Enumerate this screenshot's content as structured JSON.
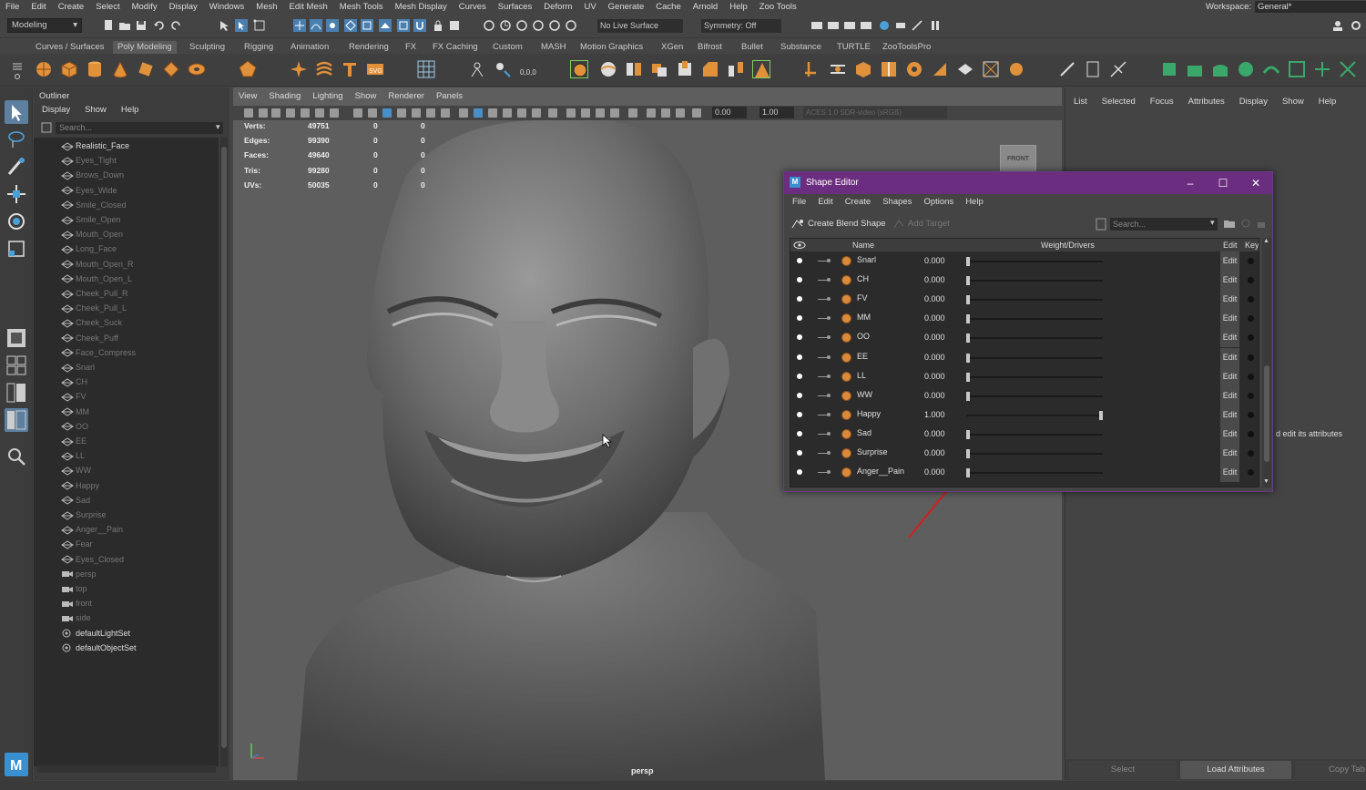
{
  "menubar": {
    "items": [
      "File",
      "Edit",
      "Create",
      "Select",
      "Modify",
      "Display",
      "Windows",
      "Mesh",
      "Edit Mesh",
      "Mesh Tools",
      "Mesh Display",
      "Curves",
      "Surfaces",
      "Deform",
      "UV",
      "Generate",
      "Cache",
      "Arnold",
      "Help",
      "Zoo Tools"
    ],
    "workspace_label": "Workspace:",
    "workspace_value": "General*"
  },
  "statusline": {
    "mode": "Modeling",
    "live_surface": "No Live Surface",
    "symmetry": "Symmetry: Off"
  },
  "shelf": {
    "tabs": [
      "Curves / Surfaces",
      "Poly Modeling",
      "Sculpting",
      "Rigging",
      "Animation",
      "Rendering",
      "FX",
      "FX Caching",
      "Custom",
      "MASH",
      "Motion Graphics",
      "XGen",
      "Bifrost",
      "Bullet",
      "Substance",
      "TURTLE",
      "ZooToolsPro"
    ],
    "active_tab": "Poly Modeling"
  },
  "outliner": {
    "title": "Outliner",
    "menu": [
      "Display",
      "Show",
      "Help"
    ],
    "search_placeholder": "Search...",
    "items": [
      {
        "label": "Realistic_Face",
        "dim": false,
        "kind": "mesh"
      },
      {
        "label": "Eyes_Tight",
        "dim": true,
        "kind": "mesh"
      },
      {
        "label": "Brows_Down",
        "dim": true,
        "kind": "mesh"
      },
      {
        "label": "Eyes_Wide",
        "dim": true,
        "kind": "mesh"
      },
      {
        "label": "Smile_Closed",
        "dim": true,
        "kind": "mesh"
      },
      {
        "label": "Smile_Open",
        "dim": true,
        "kind": "mesh"
      },
      {
        "label": "Mouth_Open",
        "dim": true,
        "kind": "mesh"
      },
      {
        "label": "Long_Face",
        "dim": true,
        "kind": "mesh"
      },
      {
        "label": "Mouth_Open_R",
        "dim": true,
        "kind": "mesh"
      },
      {
        "label": "Mouth_Open_L",
        "dim": true,
        "kind": "mesh"
      },
      {
        "label": "Cheek_Pull_R",
        "dim": true,
        "kind": "mesh"
      },
      {
        "label": "Cheek_Pull_L",
        "dim": true,
        "kind": "mesh"
      },
      {
        "label": "Cheek_Suck",
        "dim": true,
        "kind": "mesh"
      },
      {
        "label": "Cheek_Puff",
        "dim": true,
        "kind": "mesh"
      },
      {
        "label": "Face_Compress",
        "dim": true,
        "kind": "mesh"
      },
      {
        "label": "Snarl",
        "dim": true,
        "kind": "mesh"
      },
      {
        "label": "CH",
        "dim": true,
        "kind": "mesh"
      },
      {
        "label": "FV",
        "dim": true,
        "kind": "mesh"
      },
      {
        "label": "MM",
        "dim": true,
        "kind": "mesh"
      },
      {
        "label": "OO",
        "dim": true,
        "kind": "mesh"
      },
      {
        "label": "EE",
        "dim": true,
        "kind": "mesh"
      },
      {
        "label": "LL",
        "dim": true,
        "kind": "mesh"
      },
      {
        "label": "WW",
        "dim": true,
        "kind": "mesh"
      },
      {
        "label": "Happy",
        "dim": true,
        "kind": "mesh"
      },
      {
        "label": "Sad",
        "dim": true,
        "kind": "mesh"
      },
      {
        "label": "Surprise",
        "dim": true,
        "kind": "mesh"
      },
      {
        "label": "Anger__Pain",
        "dim": true,
        "kind": "mesh"
      },
      {
        "label": "Fear",
        "dim": true,
        "kind": "mesh"
      },
      {
        "label": "Eyes_Closed",
        "dim": true,
        "kind": "mesh"
      },
      {
        "label": "persp",
        "dim": true,
        "kind": "camera"
      },
      {
        "label": "top",
        "dim": true,
        "kind": "camera"
      },
      {
        "label": "front",
        "dim": true,
        "kind": "camera"
      },
      {
        "label": "side",
        "dim": true,
        "kind": "camera"
      },
      {
        "label": "defaultLightSet",
        "dim": false,
        "kind": "set"
      },
      {
        "label": "defaultObjectSet",
        "dim": false,
        "kind": "set"
      }
    ]
  },
  "viewport": {
    "menu": [
      "View",
      "Shading",
      "Lighting",
      "Show",
      "Renderer",
      "Panels"
    ],
    "exposure": "0.00",
    "gamma": "1.00",
    "color_space": "ACES 1.0 SDR-video (sRGB)",
    "hud": [
      {
        "label": "Verts:",
        "v1": "49751",
        "v2": "0",
        "v3": "0"
      },
      {
        "label": "Edges:",
        "v1": "99390",
        "v2": "0",
        "v3": "0"
      },
      {
        "label": "Faces:",
        "v1": "49640",
        "v2": "0",
        "v3": "0"
      },
      {
        "label": "Tris:",
        "v1": "99280",
        "v2": "0",
        "v3": "0"
      },
      {
        "label": "UVs:",
        "v1": "50035",
        "v2": "0",
        "v3": "0"
      }
    ],
    "camera_label": "persp",
    "viewcube_label": "FRONT"
  },
  "shape_editor": {
    "title": "Shape Editor",
    "menu": [
      "File",
      "Edit",
      "Create",
      "Shapes",
      "Options",
      "Help"
    ],
    "create_blend_shape": "Create Blend Shape",
    "add_target": "Add Target",
    "search_placeholder": "Search...",
    "col_name": "Name",
    "col_weight": "Weight/Drivers",
    "col_edit": "Edit",
    "col_key": "Key",
    "edit_label": "Edit",
    "targets": [
      {
        "name": "Snarl",
        "weight": "0.000",
        "fraction": 0
      },
      {
        "name": "CH",
        "weight": "0.000",
        "fraction": 0
      },
      {
        "name": "FV",
        "weight": "0.000",
        "fraction": 0
      },
      {
        "name": "MM",
        "weight": "0.000",
        "fraction": 0
      },
      {
        "name": "OO",
        "weight": "0.000",
        "fraction": 0
      },
      {
        "name": "EE",
        "weight": "0.000",
        "fraction": 0
      },
      {
        "name": "LL",
        "weight": "0.000",
        "fraction": 0
      },
      {
        "name": "WW",
        "weight": "0.000",
        "fraction": 0
      },
      {
        "name": "Happy",
        "weight": "1.000",
        "fraction": 1
      },
      {
        "name": "Sad",
        "weight": "0.000",
        "fraction": 0
      },
      {
        "name": "Surprise",
        "weight": "0.000",
        "fraction": 0
      },
      {
        "name": "Anger__Pain",
        "weight": "0.000",
        "fraction": 0
      }
    ]
  },
  "attribute_editor": {
    "menu": [
      "List",
      "Selected",
      "Focus",
      "Attributes",
      "Display",
      "Show",
      "Help"
    ],
    "hint": "d edit its attributes",
    "select_btn": "Select",
    "load_btn": "Load Attributes",
    "copy_btn": "Copy Tab"
  },
  "colors": {
    "accent_orange": "#e0913a",
    "title_purple": "#6b2d7f",
    "annotation_red": "#d21e1e"
  }
}
